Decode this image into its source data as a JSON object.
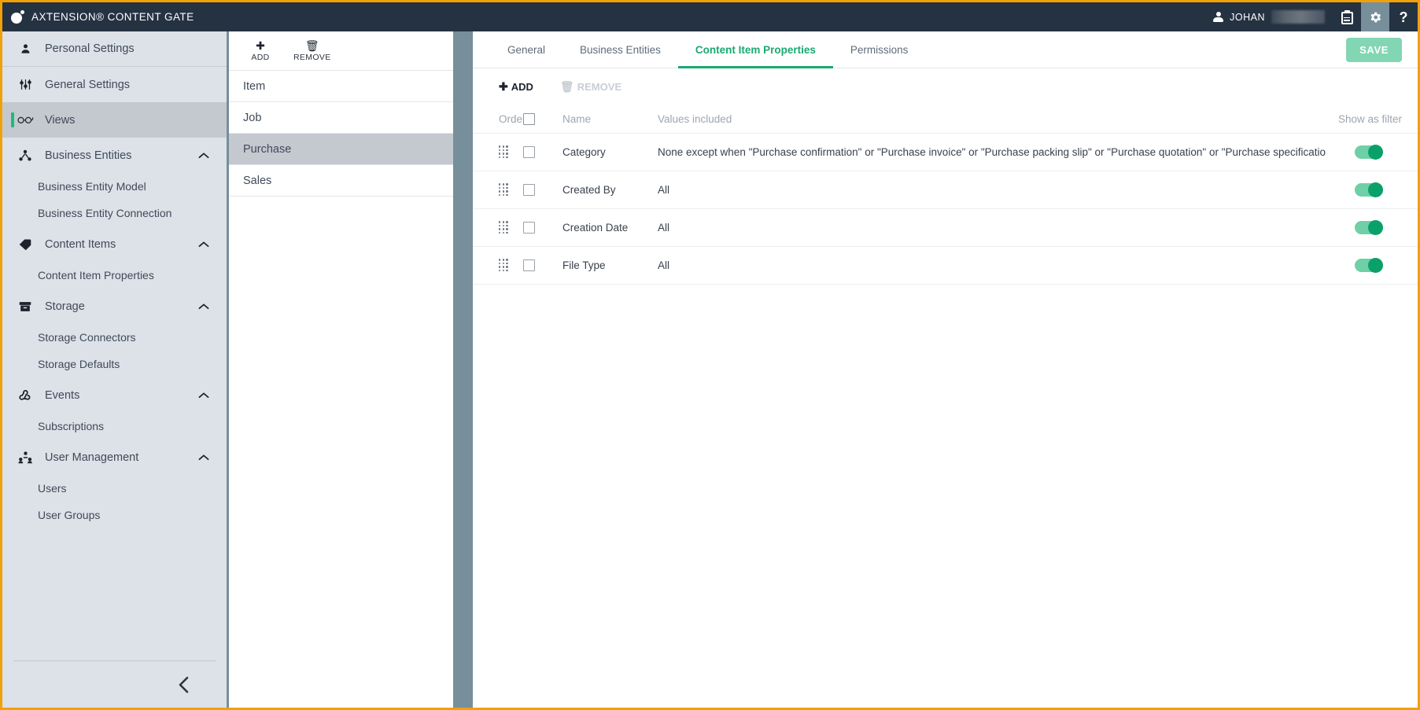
{
  "app": {
    "title": "AXTENSION® CONTENT GATE",
    "logo_icon": "content-gate-logo-icon"
  },
  "topbar": {
    "user_name": "JOHAN",
    "user_icon": "person-icon",
    "clipboard_icon": "clipboard-icon",
    "gear_icon": "gear-icon",
    "help_icon": "question-mark-icon",
    "help_label": "?"
  },
  "sidebar": {
    "items": [
      {
        "label": "Personal Settings",
        "icon": "person-icon",
        "type": "top",
        "selected": false
      },
      {
        "label": "General Settings",
        "icon": "sliders-icon",
        "type": "top",
        "selected": false
      },
      {
        "label": "Views",
        "icon": "glasses-icon",
        "type": "top",
        "selected": true
      },
      {
        "label": "Business Entities",
        "icon": "network-nodes-icon",
        "type": "group",
        "expanded": true
      },
      {
        "label": "Business Entity Model",
        "type": "sub"
      },
      {
        "label": "Business Entity Connection",
        "type": "sub"
      },
      {
        "label": "Content Items",
        "icon": "tag-icon",
        "type": "group",
        "expanded": true
      },
      {
        "label": "Content Item Properties",
        "type": "sub"
      },
      {
        "label": "Storage",
        "icon": "archive-box-icon",
        "type": "group",
        "expanded": true
      },
      {
        "label": "Storage Connectors",
        "type": "sub"
      },
      {
        "label": "Storage Defaults",
        "type": "sub"
      },
      {
        "label": "Events",
        "icon": "events-webhook-icon",
        "type": "group",
        "expanded": true
      },
      {
        "label": "Subscriptions",
        "type": "sub"
      },
      {
        "label": "User Management",
        "icon": "users-group-icon",
        "type": "group",
        "expanded": true
      },
      {
        "label": "Users",
        "type": "sub"
      },
      {
        "label": "User Groups",
        "type": "sub"
      }
    ],
    "collapse_icon": "chevron-left-icon"
  },
  "midpanel": {
    "toolbar": {
      "add_label": "ADD",
      "add_icon": "plus-icon",
      "remove_label": "REMOVE",
      "remove_icon": "trash-icon"
    },
    "rows": [
      {
        "label": "Item",
        "selected": false
      },
      {
        "label": "Job",
        "selected": false
      },
      {
        "label": "Purchase",
        "selected": true
      },
      {
        "label": "Sales",
        "selected": false
      }
    ]
  },
  "main": {
    "tabs": [
      {
        "label": "General",
        "active": false
      },
      {
        "label": "Business Entities",
        "active": false
      },
      {
        "label": "Content Item Properties",
        "active": true
      },
      {
        "label": "Permissions",
        "active": false
      }
    ],
    "save_label": "SAVE",
    "toolbar": {
      "add_label": "ADD",
      "add_icon": "plus-icon",
      "remove_label": "REMOVE",
      "remove_icon": "trash-icon"
    },
    "grid": {
      "headers": {
        "order": "Order",
        "name": "Name",
        "values": "Values included",
        "filter": "Show as filter"
      },
      "rows": [
        {
          "name": "Category",
          "values": "None except when \"Purchase confirmation\" or \"Purchase invoice\" or \"Purchase packing slip\" or \"Purchase quotation\" or \"Purchase specificatio",
          "checked": false,
          "show_as_filter": true
        },
        {
          "name": "Created By",
          "values": "All",
          "checked": false,
          "show_as_filter": true
        },
        {
          "name": "Creation Date",
          "values": "All",
          "checked": false,
          "show_as_filter": true
        },
        {
          "name": "File Type",
          "values": "All",
          "checked": false,
          "show_as_filter": true
        }
      ]
    }
  },
  "colors": {
    "topbar_bg": "#253242",
    "frame_border": "#f2a007",
    "page_bg": "#778e9b",
    "sidebar_bg": "#dde1e8",
    "accent_green": "#19a971",
    "save_green": "#83d6b3",
    "toggle_on": "#0aa06a"
  }
}
